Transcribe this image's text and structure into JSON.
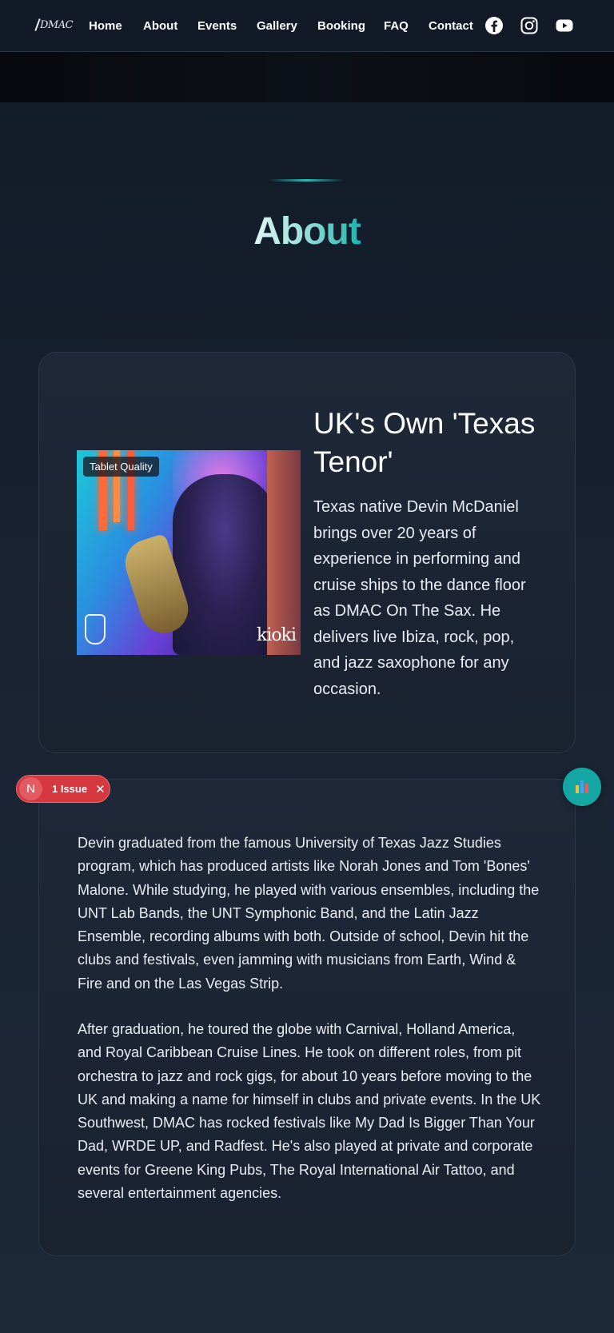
{
  "nav": {
    "logo_text": "DMAC",
    "links": [
      "Home",
      "About",
      "Events",
      "Gallery",
      "Booking",
      "FAQ",
      "Contact"
    ],
    "social_icons": [
      "facebook-icon",
      "instagram-icon",
      "youtube-icon"
    ]
  },
  "page": {
    "title": "About"
  },
  "intro": {
    "image_badge": "Tablet Quality",
    "image_watermark": "kioki",
    "heading": "UK's Own 'Texas Tenor'",
    "text": "Texas native Devin McDaniel brings over 20 years of experience in performing and cruise ships to the dance floor as DMAC On The Sax. He delivers live Ibiza, rock, pop, and jazz saxophone for any occasion."
  },
  "bio": {
    "paragraphs": [
      "Devin graduated from the famous University of Texas Jazz Studies program, which has produced artists like Norah Jones and Tom 'Bones' Malone. While studying, he played with various ensembles, including the UNT Lab Bands, the UNT Symphonic Band, and the Latin Jazz Ensemble, recording albums with both. Outside of school, Devin hit the clubs and festivals, even jamming with musicians from Earth, Wind & Fire and on the Las Vegas Strip.",
      "After graduation, he toured the globe with Carnival, Holland America, and Royal Caribbean Cruise Lines. He took on different roles, from pit orchestra to jazz and rock gigs, for about 10 years before moving to the UK and making a name for himself in clubs and private events. In the UK Southwest, DMAC has rocked festivals like My Dad Is Bigger Than Your Dad, WRDE UP, and Radfest. He's also played at private and corporate events for Greene King Pubs, The Royal International Air Tattoo, and several entertainment agencies."
    ]
  },
  "dev_overlay": {
    "issue_initial": "N",
    "issue_label": "1 Issue",
    "close_symbol": "✕"
  },
  "colors": {
    "accent": "#14a6a2",
    "issue_red": "#d6383f",
    "background": "#121a27"
  }
}
